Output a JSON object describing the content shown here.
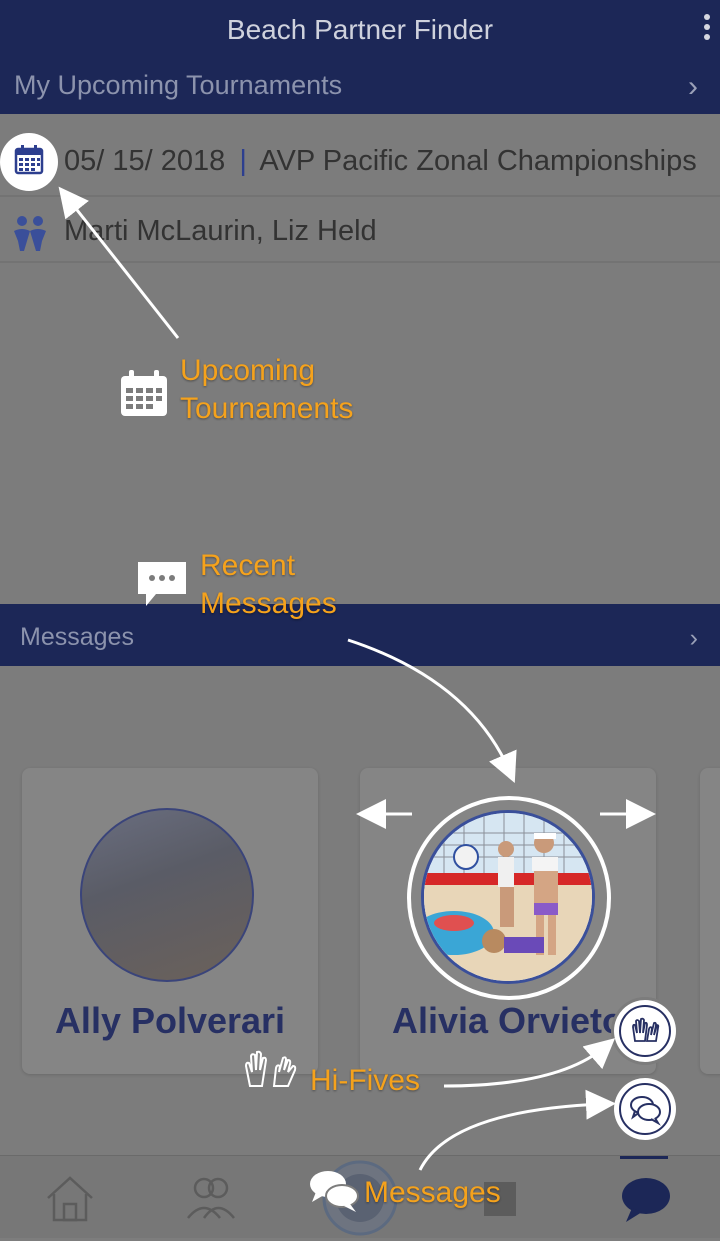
{
  "app": {
    "title": "Beach Partner Finder"
  },
  "upcoming": {
    "header": "My Upcoming Tournaments",
    "date": "05/ 15/ 2018",
    "separator": "|",
    "tournament": "AVP Pacific Zonal Championships",
    "players": "Marti McLaurin, Liz Held"
  },
  "messages": {
    "header": "Messages",
    "cards": [
      {
        "name": "Ally Polverari"
      },
      {
        "name": "Alivia Orvieto"
      }
    ]
  },
  "annotations": {
    "upcoming_line1": "Upcoming",
    "upcoming_line2": "Tournaments",
    "recent_line1": "Recent",
    "recent_line2": "Messages",
    "hifives": "Hi-Fives",
    "messages": "Messages"
  },
  "tabs": [
    {
      "icon": "home-icon"
    },
    {
      "icon": "users-icon"
    },
    {
      "icon": "logo-icon"
    },
    {
      "icon": "calendar-icon"
    },
    {
      "icon": "chat-icon"
    }
  ],
  "colors": {
    "navy": "#1c2757",
    "accent": "#f5a21c",
    "overlay_gray": "#7c7c7c"
  }
}
